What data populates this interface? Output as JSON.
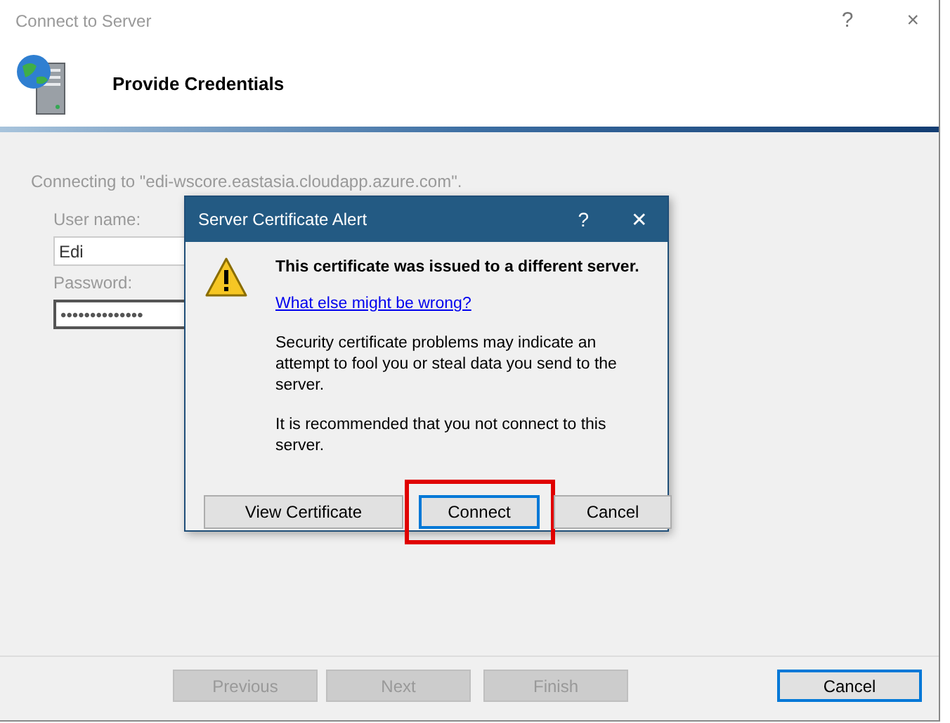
{
  "window": {
    "title": "Connect to Server",
    "controls": [
      "?",
      "×"
    ]
  },
  "header": {
    "title": "Provide Credentials"
  },
  "connecting_text": "Connecting to \"edi-wscore.eastasia.cloudapp.azure.com\".",
  "fields": [
    {
      "label": "User name:",
      "value": "Edi",
      "focused": false
    },
    {
      "label": "Password:",
      "value": "••••••••••••••",
      "focused": true
    }
  ],
  "buttons": [
    {
      "label": "Previous",
      "disabled": true,
      "focused": false
    },
    {
      "label": "Next",
      "disabled": true,
      "focused": false
    },
    {
      "label": "Finish",
      "disabled": true,
      "focused": false
    },
    {
      "label": "Cancel",
      "disabled": false,
      "focused": true
    }
  ],
  "dialog": {
    "title": "Server Certificate Alert",
    "controls": [
      "?",
      "✕"
    ],
    "heading": "This certificate was issued to a different server.",
    "link": "What else might be wrong?",
    "paragraphs": [
      "Security certificate problems may indicate an attempt to fool you or steal data you send to the server.",
      "It is recommended that you not connect to this server."
    ],
    "buttons": [
      {
        "label": "View Certificate",
        "focused": false,
        "highlighted": false
      },
      {
        "label": "Connect",
        "focused": true,
        "highlighted": true
      },
      {
        "label": "Cancel",
        "focused": false,
        "highlighted": false
      }
    ]
  }
}
